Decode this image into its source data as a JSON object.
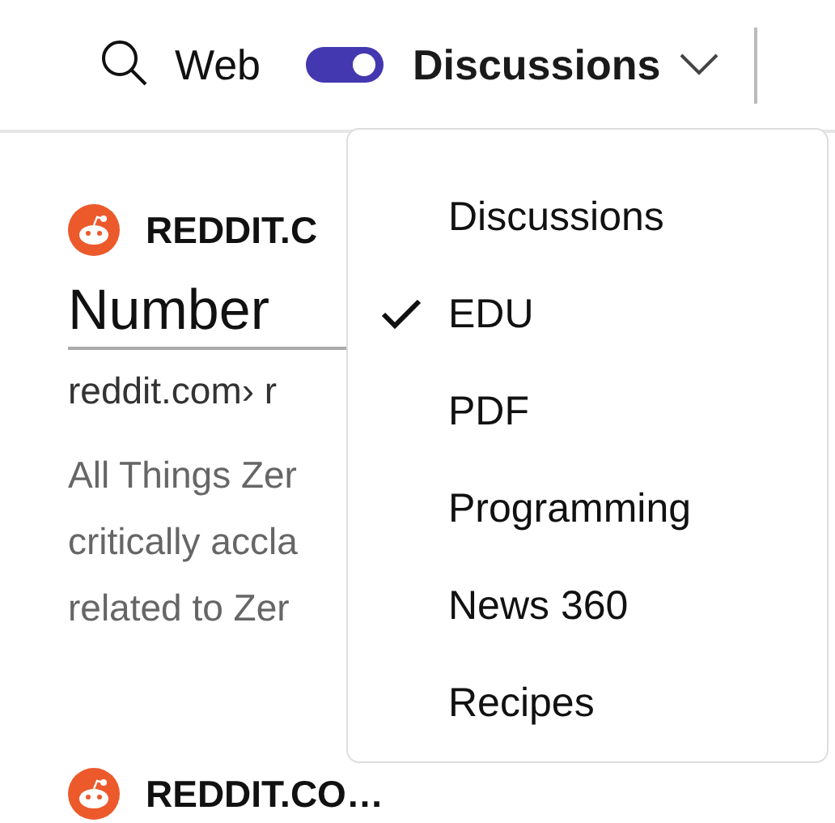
{
  "header": {
    "web_label": "Web",
    "toggle": {
      "on": true
    },
    "vertical": "Discussions"
  },
  "results": [
    {
      "site": "REDDIT.C",
      "title": "Number",
      "url": "reddit.com› r",
      "snippet": [
        "All Things Zer",
        "critically accla",
        "related to Zer"
      ]
    },
    {
      "site": "REDDIT.CO…"
    }
  ],
  "dropdown": {
    "items": [
      {
        "label": "Discussions",
        "selected": false
      },
      {
        "label": "EDU",
        "selected": true
      },
      {
        "label": "PDF",
        "selected": false
      },
      {
        "label": "Programming",
        "selected": false
      },
      {
        "label": "News 360",
        "selected": false
      },
      {
        "label": "Recipes",
        "selected": false
      }
    ]
  }
}
